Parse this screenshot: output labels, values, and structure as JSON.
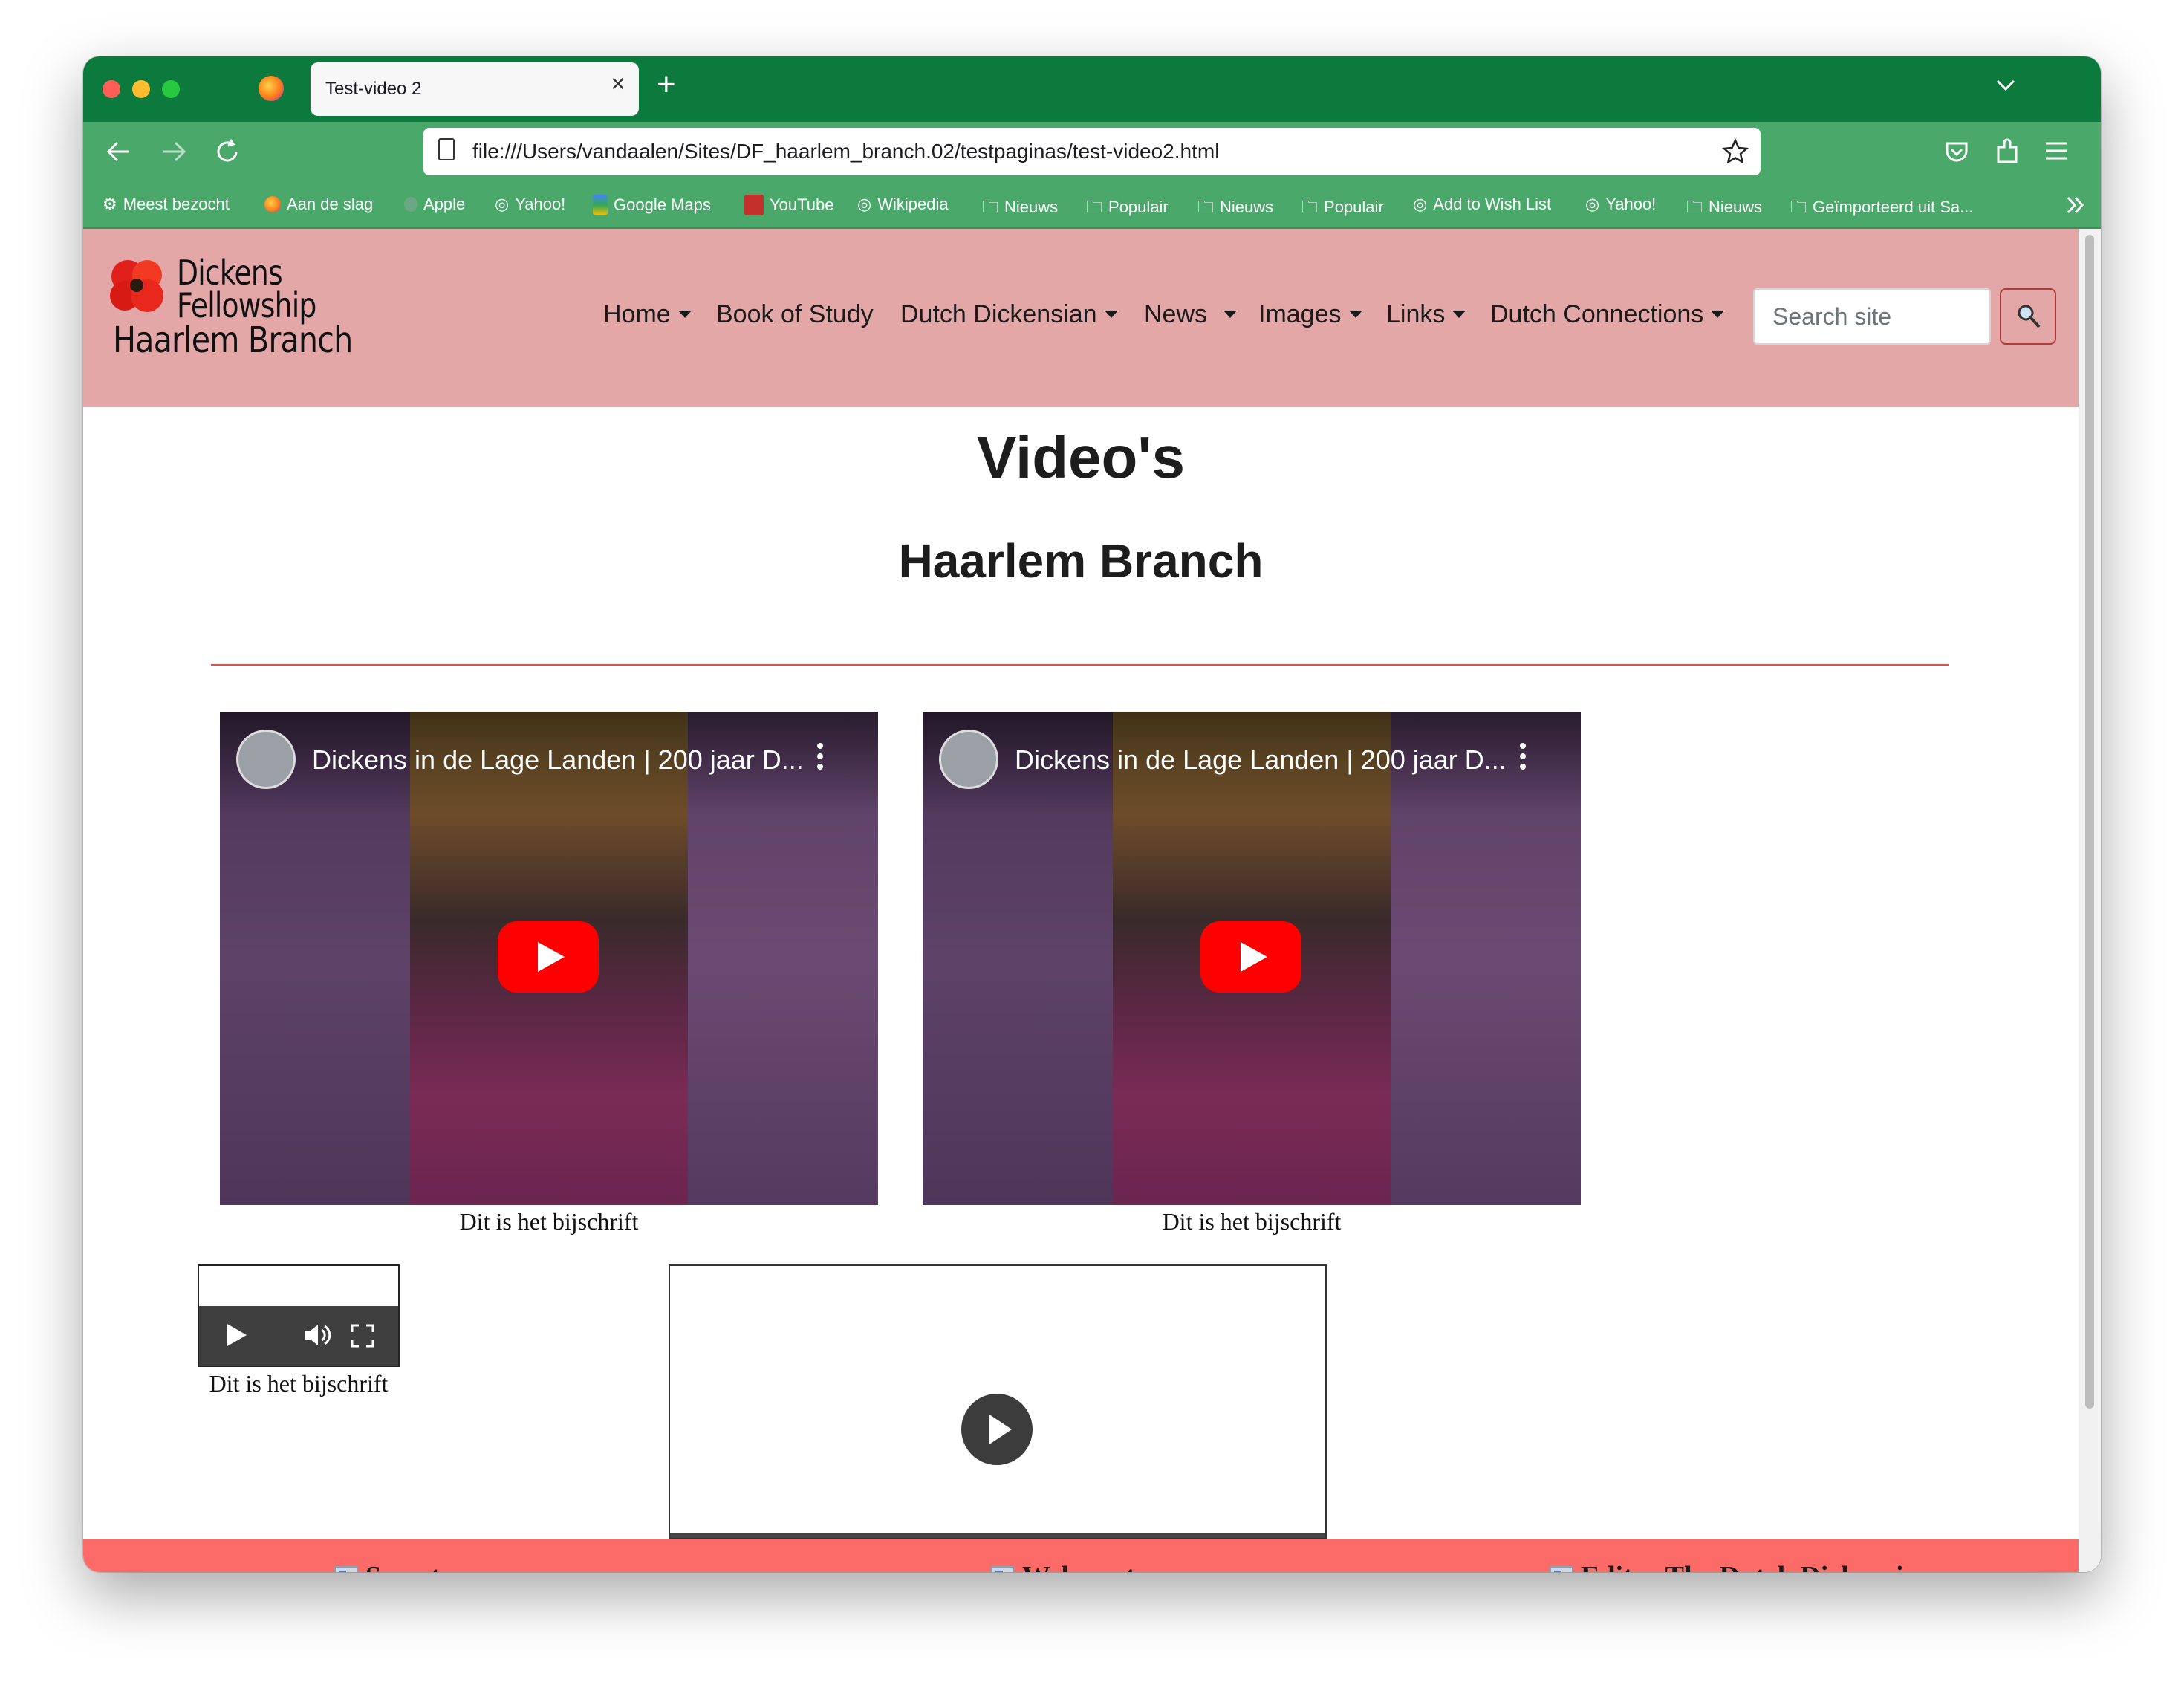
{
  "browser": {
    "tab_title": "Test-video 2",
    "url": "file:///Users/vandaalen/Sites/DF_haarlem_branch.02/testpaginas/test-video2.html",
    "bookmarks": [
      {
        "label": "Meest bezocht",
        "icon": "gear-icon"
      },
      {
        "label": "Aan de slag",
        "icon": "firefox-icon"
      },
      {
        "label": "Apple",
        "icon": "apple-icon"
      },
      {
        "label": "Yahoo!",
        "icon": "globe-icon"
      },
      {
        "label": "Google Maps",
        "icon": "google-maps-icon"
      },
      {
        "label": "YouTube",
        "icon": "youtube-icon"
      },
      {
        "label": "Wikipedia",
        "icon": "globe-icon"
      },
      {
        "label": "Nieuws",
        "icon": "folder-icon"
      },
      {
        "label": "Populair",
        "icon": "folder-icon"
      },
      {
        "label": "Nieuws",
        "icon": "folder-icon"
      },
      {
        "label": "Populair",
        "icon": "folder-icon"
      },
      {
        "label": "Add to Wish List",
        "icon": "globe-icon"
      },
      {
        "label": "Yahoo!",
        "icon": "globe-icon"
      },
      {
        "label": "Nieuws",
        "icon": "folder-icon"
      },
      {
        "label": "Geïmporteerd uit Sa...",
        "icon": "folder-icon"
      }
    ]
  },
  "site": {
    "logo": {
      "line1": "Dickens",
      "line2": "Fellowship",
      "line3": "Haarlem Branch"
    },
    "menu": [
      {
        "label": "Home",
        "dropdown": true
      },
      {
        "label": "Book of Study",
        "dropdown": false
      },
      {
        "label": "Dutch Dickensian",
        "dropdown": true
      },
      {
        "label": "News",
        "dropdown": true
      },
      {
        "label": "Images",
        "dropdown": true
      },
      {
        "label": "Links",
        "dropdown": true
      },
      {
        "label": "Dutch Connections",
        "dropdown": true
      }
    ],
    "search_placeholder": "Search site",
    "colors": {
      "header": "#e3a7a8",
      "footer": "#fd6b68",
      "rule": "#d9534f"
    }
  },
  "main": {
    "title": "Video's",
    "subtitle": "Haarlem Branch",
    "videos": [
      {
        "title": "Dickens in de Lage Landen | 200 jaar D...",
        "caption": "Dit is het bijschrift"
      },
      {
        "title": "Dickens in de Lage Landen | 200 jaar D...",
        "caption": "Dit is het bijschrift"
      }
    ],
    "audio_caption": "Dit is het bijschrift"
  },
  "footer": {
    "links": [
      "Secretary",
      "Webmaster",
      "Editor The Dutch Dickensian"
    ]
  }
}
